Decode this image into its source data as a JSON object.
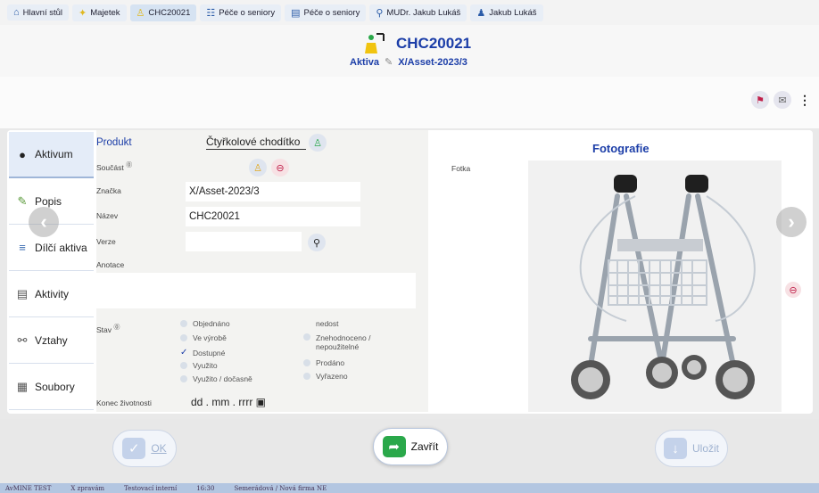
{
  "breadcrumbs": [
    {
      "label": "Hlavní stůl",
      "icon": "home-icon"
    },
    {
      "label": "Majetek",
      "icon": "asset-icon"
    },
    {
      "label": "CHC20021",
      "icon": "walker-icon"
    },
    {
      "label": "Péče o seniory",
      "icon": "org-icon"
    },
    {
      "label": "Péče o seniory",
      "icon": "table-icon"
    },
    {
      "label": "MUDr. Jakub Lukáš",
      "icon": "person-icon"
    },
    {
      "label": "Jakub Lukáš",
      "icon": "person-role-icon"
    }
  ],
  "header": {
    "title": "CHC20021",
    "status": "Aktiva",
    "code": "X/Asset-2023/3"
  },
  "tabs": [
    {
      "label": "Aktivum",
      "icon": "dot-icon",
      "active": true
    },
    {
      "label": "Popis",
      "icon": "edit-icon"
    },
    {
      "label": "Dílčí aktiva",
      "icon": "subitems-icon"
    },
    {
      "label": "Aktivity",
      "icon": "list-icon"
    },
    {
      "label": "Vztahy",
      "icon": "relations-icon"
    },
    {
      "label": "Soubory",
      "icon": "files-icon"
    }
  ],
  "form": {
    "produkt_label": "Produkt",
    "produkt_value": "Čtyřkolové chodítko",
    "soucast_label": "Součást",
    "znacka_label": "Značka",
    "znacka_value": "X/Asset-2023/3",
    "nazev_label": "Název",
    "nazev_value": "CHC20021",
    "verze_label": "Verze",
    "anotace_label": "Anotace",
    "stav_label": "Stav",
    "konec_label": "Konec životnosti",
    "konec_placeholder": "dd . mm . rrrr"
  },
  "stav_options_left": [
    {
      "label": "Objednáno",
      "checked": false
    },
    {
      "label": "Ve výrobě",
      "checked": false
    },
    {
      "label": "Dostupné",
      "checked": true
    },
    {
      "label": "Využito",
      "checked": false
    },
    {
      "label": "Využito / dočasně",
      "checked": false
    }
  ],
  "stav_options_right": [
    {
      "label": "nedost",
      "checked": false
    },
    {
      "label": "Znehodnoceno / nepoužitelné",
      "checked": false
    },
    {
      "label": "Prodáno",
      "checked": false
    },
    {
      "label": "Vyřazeno",
      "checked": false
    }
  ],
  "photo": {
    "fotka_label": "Fotka",
    "title": "Fotografie"
  },
  "buttons": {
    "ok": "OK",
    "zavrit": "Zavřít",
    "ulozit": "Uložit"
  },
  "status_bar": [
    "AvMINE TEST",
    "X zpravám",
    "Testovací interní",
    "16:30",
    "Semerádová / Nová firma NE"
  ],
  "colors": {
    "accent": "#1c3ea8",
    "danger": "#c0204a",
    "success": "#2aa84a"
  }
}
